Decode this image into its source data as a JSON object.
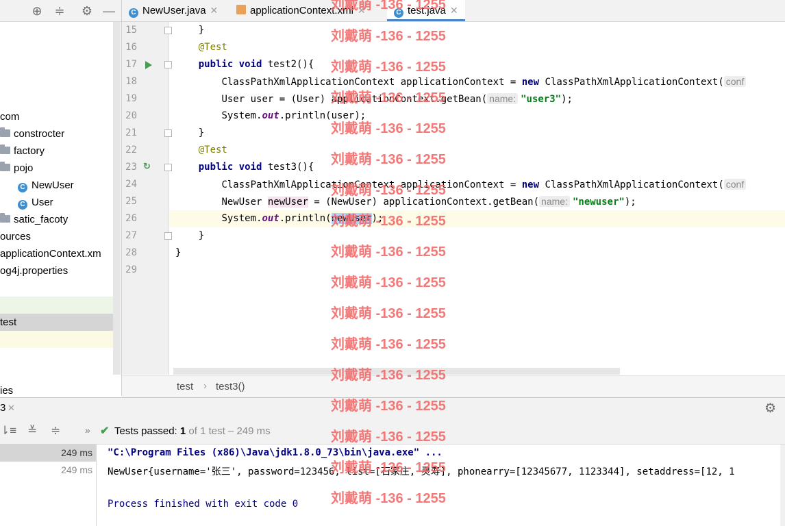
{
  "sidebar": {
    "items": [
      {
        "label": "com",
        "type": "text"
      },
      {
        "label": "constrocter",
        "type": "folder"
      },
      {
        "label": "factory",
        "type": "folder"
      },
      {
        "label": "pojo",
        "type": "folder"
      },
      {
        "label": "NewUser",
        "type": "class"
      },
      {
        "label": "User",
        "type": "class"
      },
      {
        "label": "satic_facoty",
        "type": "folder"
      },
      {
        "label": "ources",
        "type": "text"
      },
      {
        "label": "applicationContext.xm",
        "type": "text"
      },
      {
        "label": "og4j.properties",
        "type": "text"
      },
      {
        "label": "test",
        "type": "text"
      },
      {
        "label": "ies",
        "type": "text"
      }
    ]
  },
  "tabs": [
    {
      "label": "NewUser.java",
      "icon": "class-icon"
    },
    {
      "label": "applicationContext.xml",
      "icon": "xml-icon"
    },
    {
      "label": "test.java",
      "icon": "class-icon",
      "active": true
    }
  ],
  "editor": {
    "line_numbers": [
      "15",
      "16",
      "17",
      "18",
      "19",
      "20",
      "21",
      "22",
      "23",
      "24",
      "25",
      "26",
      "27",
      "28",
      "29"
    ],
    "lines": {
      "l15": "    }",
      "l16_ann": "@Test",
      "l17_kw": "public void",
      "l17_rest": " test2(){",
      "l18_a": "ClassPathXmlApplicationContext applicationContext = ",
      "l18_kw": "new",
      "l18_b": " ClassPathXmlApplicationContext(",
      "l18_hint": "conf",
      "l19_a": "User user = (User) applicationContext.getBean(",
      "l19_hint": "name:",
      "l19_str": "\"user3\"",
      "l19_end": ");",
      "l20_a": "System.",
      "l20_fld": "out",
      "l20_b": ".println(user);",
      "l21": "    }",
      "l22_ann": "@Test",
      "l23_kw": "public void",
      "l23_rest": " test3(){",
      "l24_a": "ClassPathXmlApplicationContext applicationContext = ",
      "l24_kw": "new",
      "l24_b": " ClassPathXmlApplicationContext(",
      "l24_hint": "conf",
      "l25_a": "NewUser ",
      "l25_var": "newUser",
      "l25_b": " = (NewUser) applicationContext.getBean(",
      "l25_hint": "name:",
      "l25_str": "\"newuser\"",
      "l25_end": ");",
      "l26_a": "System.",
      "l26_fld": "out",
      "l26_b": ".println(",
      "l26_sel": "newUser",
      "l26_end": ");",
      "l27": "    }",
      "l28": "}"
    }
  },
  "breadcrumb": {
    "items": [
      "test",
      "test3()"
    ],
    "separator": "›"
  },
  "run": {
    "tab_label": "3",
    "status_prefix": "Tests passed: ",
    "status_count": "1",
    "status_suffix": " of 1 test – 249 ms",
    "left_times": [
      "249 ms",
      "249 ms"
    ],
    "console": [
      "\"C:\\Program Files (x86)\\Java\\jdk1.8.0_73\\bin\\java.exe\" ...",
      "NewUser{username='张三', password=123456, list=[石家庄, 灵寿], phonearry=[12345677, 1123344], setaddress=[12, 1",
      "",
      "Process finished with exit code 0"
    ]
  },
  "watermark": "刘戴萌 -136 - 1255",
  "colors": {
    "accent": "#4a86c7",
    "keyword": "#000080",
    "string": "#067d17",
    "annotation": "#808000",
    "watermark": "#f26b6b",
    "pass": "#499c54"
  }
}
